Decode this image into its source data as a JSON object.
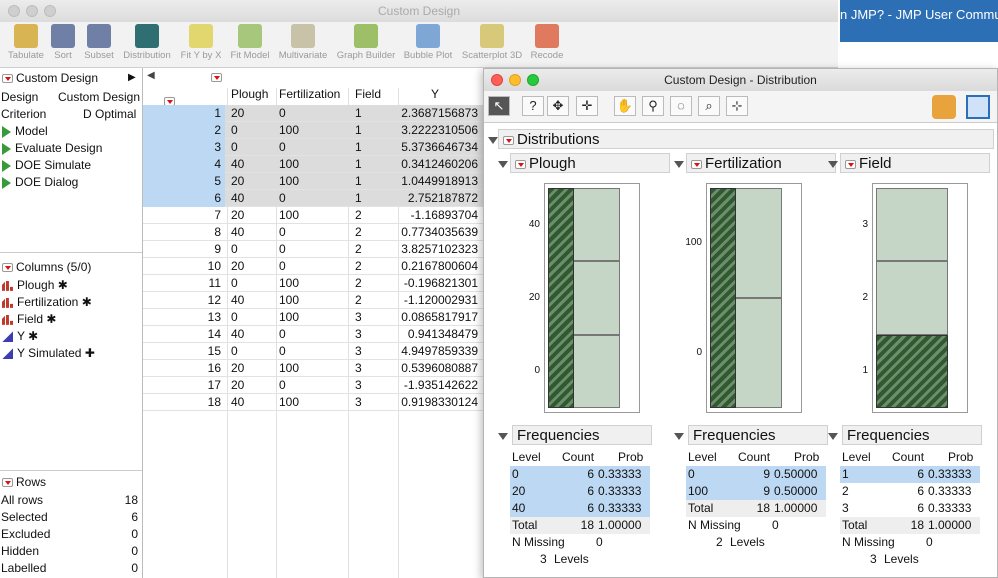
{
  "bg": {
    "browser_text": "n JMP? - JMP User Community"
  },
  "main_window": {
    "title": "Custom Design",
    "toolbar": [
      "Tabulate",
      "Sort",
      "Subset",
      "Distribution",
      "Fit Y by X",
      "Fit Model",
      "Multivariate",
      "Graph Builder",
      "Bubble Plot",
      "Scatterplot 3D",
      "Recode"
    ]
  },
  "table_panel": {
    "title": "Custom Design",
    "props": [
      {
        "k": "Design",
        "v": "Custom Design"
      },
      {
        "k": "Criterion",
        "v": "D Optimal"
      }
    ],
    "scripts": [
      "Model",
      "Evaluate Design",
      "DOE Simulate",
      "DOE Dialog"
    ]
  },
  "columns_panel": {
    "title": "Columns (5/0)",
    "items": [
      {
        "name": "Plough",
        "mark": "✱"
      },
      {
        "name": "Fertilization",
        "mark": "✱"
      },
      {
        "name": "Field",
        "mark": "✱"
      },
      {
        "name": "Y",
        "mark": "✱"
      },
      {
        "name": "Y Simulated",
        "mark": "✚"
      }
    ]
  },
  "rows_panel": {
    "title": "Rows",
    "items": [
      {
        "k": "All rows",
        "v": "18"
      },
      {
        "k": "Selected",
        "v": "6"
      },
      {
        "k": "Excluded",
        "v": "0"
      },
      {
        "k": "Hidden",
        "v": "0"
      },
      {
        "k": "Labelled",
        "v": "0"
      }
    ]
  },
  "grid": {
    "headers": [
      "Plough",
      "Fertilization",
      "Field",
      "Y"
    ],
    "rows": [
      [
        "1",
        "20",
        "0",
        "1",
        "2.3687156873"
      ],
      [
        "2",
        "0",
        "100",
        "1",
        "3.2222310506"
      ],
      [
        "3",
        "0",
        "0",
        "1",
        "5.3736646734"
      ],
      [
        "4",
        "40",
        "100",
        "1",
        "0.3412460206"
      ],
      [
        "5",
        "20",
        "100",
        "1",
        "1.0449918913"
      ],
      [
        "6",
        "40",
        "0",
        "1",
        "2.752187872"
      ],
      [
        "7",
        "20",
        "100",
        "2",
        "-1.16893704"
      ],
      [
        "8",
        "40",
        "0",
        "2",
        "0.7734035639"
      ],
      [
        "9",
        "0",
        "0",
        "2",
        "3.8257102323"
      ],
      [
        "10",
        "20",
        "0",
        "2",
        "0.2167800604"
      ],
      [
        "11",
        "0",
        "100",
        "2",
        "-0.196821301"
      ],
      [
        "12",
        "40",
        "100",
        "2",
        "-1.120002931"
      ],
      [
        "13",
        "0",
        "100",
        "3",
        "0.0865817917"
      ],
      [
        "14",
        "40",
        "0",
        "3",
        "0.941348479"
      ],
      [
        "15",
        "0",
        "0",
        "3",
        "4.9497859339"
      ],
      [
        "16",
        "20",
        "100",
        "3",
        "0.5396080887"
      ],
      [
        "17",
        "20",
        "0",
        "3",
        "-1.935142622"
      ],
      [
        "18",
        "40",
        "100",
        "3",
        "0.9198330124"
      ]
    ]
  },
  "dist_window": {
    "title": "Custom Design - Distribution",
    "tools": [
      "↖",
      "?",
      "✥",
      "✛",
      "✋",
      "⚲",
      "◌",
      "⌕",
      "⊹"
    ],
    "distributions_label": "Distributions",
    "frequencies_label": "Frequencies",
    "col_level": "Level",
    "col_count": "Count",
    "col_prob": "Prob",
    "total_label": "Total",
    "missing_label": "N Missing",
    "levels_label": "Levels",
    "vars": [
      {
        "name": "Plough",
        "axis_ticks": [
          "40",
          "20",
          "0"
        ],
        "levels": [
          [
            "0",
            "6",
            "0.33333"
          ],
          [
            "20",
            "6",
            "0.33333"
          ],
          [
            "40",
            "6",
            "0.33333"
          ]
        ],
        "total": [
          "18",
          "1.00000"
        ],
        "missing": "0",
        "n_levels": "3",
        "selected_fraction": 1.0
      },
      {
        "name": "Fertilization",
        "axis_ticks": [
          "100",
          "0"
        ],
        "levels": [
          [
            "0",
            "9",
            "0.50000"
          ],
          [
            "100",
            "9",
            "0.50000"
          ]
        ],
        "total": [
          "18",
          "1.00000"
        ],
        "missing": "0",
        "n_levels": "2",
        "selected_fraction": 1.0
      },
      {
        "name": "Field",
        "axis_ticks": [
          "3",
          "2",
          "1"
        ],
        "levels": [
          [
            "1",
            "6",
            "0.33333"
          ],
          [
            "2",
            "6",
            "0.33333"
          ],
          [
            "3",
            "6",
            "0.33333"
          ]
        ],
        "total": [
          "18",
          "1.00000"
        ],
        "missing": "0",
        "n_levels": "3",
        "selected_fraction": 0.3333
      }
    ]
  }
}
